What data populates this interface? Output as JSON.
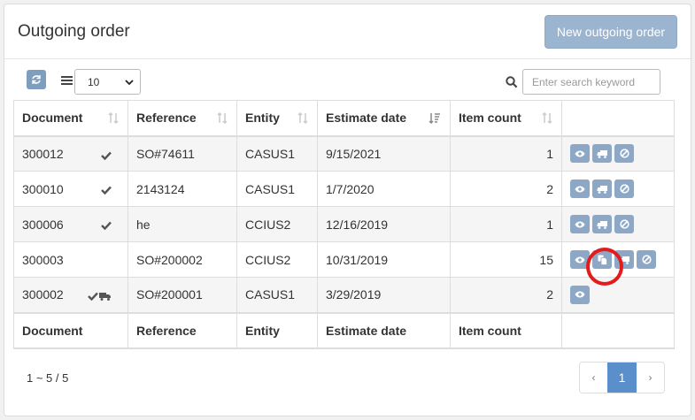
{
  "header": {
    "title": "Outgoing order",
    "new_button": "New outgoing order"
  },
  "toolbar": {
    "page_size": "10",
    "search_placeholder": "Enter search keyword"
  },
  "table": {
    "columns": [
      "Document",
      "Reference",
      "Entity",
      "Estimate date",
      "Item count"
    ],
    "footer": [
      "Document",
      "Reference",
      "Entity",
      "Estimate date",
      "Item count"
    ],
    "rows": [
      {
        "document": "300012",
        "status": "check",
        "reference": "SO#74611",
        "entity": "CASUS1",
        "date": "9/15/2021",
        "count": "1",
        "actions": [
          "view",
          "ship",
          "cancel"
        ]
      },
      {
        "document": "300010",
        "status": "check",
        "reference": "2143124",
        "entity": "CASUS1",
        "date": "1/7/2020",
        "count": "2",
        "actions": [
          "view",
          "ship",
          "cancel"
        ]
      },
      {
        "document": "300006",
        "status": "check",
        "reference": "he",
        "entity": "CCIUS2",
        "date": "12/16/2019",
        "count": "1",
        "actions": [
          "view",
          "ship",
          "cancel"
        ]
      },
      {
        "document": "300003",
        "status": "",
        "reference": "SO#200002",
        "entity": "CCIUS2",
        "date": "10/31/2019",
        "count": "15",
        "actions": [
          "view",
          "copy",
          "ship",
          "cancel"
        ]
      },
      {
        "document": "300002",
        "status": "check-truck",
        "reference": "SO#200001",
        "entity": "CASUS1",
        "date": "3/29/2019",
        "count": "2",
        "actions": [
          "view"
        ]
      }
    ]
  },
  "footer": {
    "info": "1 ~ 5 / 5",
    "prev": "‹",
    "page": "1",
    "next": "›"
  },
  "colors": {
    "accent": "#5b8fcc",
    "button": "#8ca8c6",
    "highlight": "#e41b1b"
  }
}
